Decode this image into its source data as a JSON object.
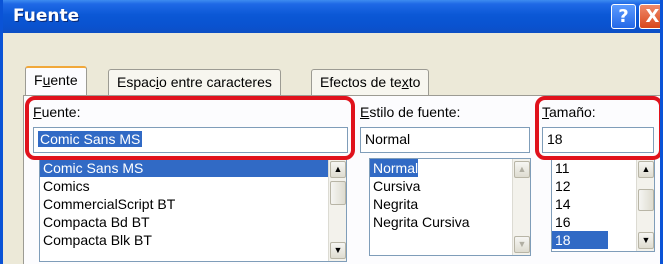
{
  "window": {
    "title": "Fuente",
    "help_label": "?",
    "close_label": "X"
  },
  "tabs": [
    {
      "label_pre": "F",
      "label_key": "u",
      "label_post": "ente",
      "active": true
    },
    {
      "label_pre": "Espac",
      "label_key": "i",
      "label_post": "o entre caracteres",
      "active": false
    },
    {
      "label_pre": "Efectos de te",
      "label_key": "x",
      "label_post": "to",
      "active": false
    }
  ],
  "font": {
    "label_key": "F",
    "label_rest": "uente:",
    "value": "Comic Sans MS",
    "items": [
      "Comic Sans MS",
      "Comics",
      "CommercialScript BT",
      "Compacta Bd BT",
      "Compacta Blk BT"
    ],
    "selected_index": 0
  },
  "style": {
    "label_key": "E",
    "label_rest": "stilo de fuente:",
    "value": "Normal",
    "items": [
      "Normal",
      "Cursiva",
      "Negrita",
      "Negrita Cursiva"
    ],
    "selected_index": 0
  },
  "size": {
    "label_key": "T",
    "label_rest": "amaño:",
    "value": "18",
    "items": [
      "11",
      "12",
      "14",
      "16",
      "18"
    ],
    "selected_index": 4
  },
  "icons": {
    "help": "help-icon",
    "close": "close-icon",
    "scroll_up": "▲",
    "scroll_down": "▼"
  },
  "colors": {
    "title_bar": "#0a52cf",
    "selection": "#316ac5",
    "highlight": "#e0121c"
  }
}
